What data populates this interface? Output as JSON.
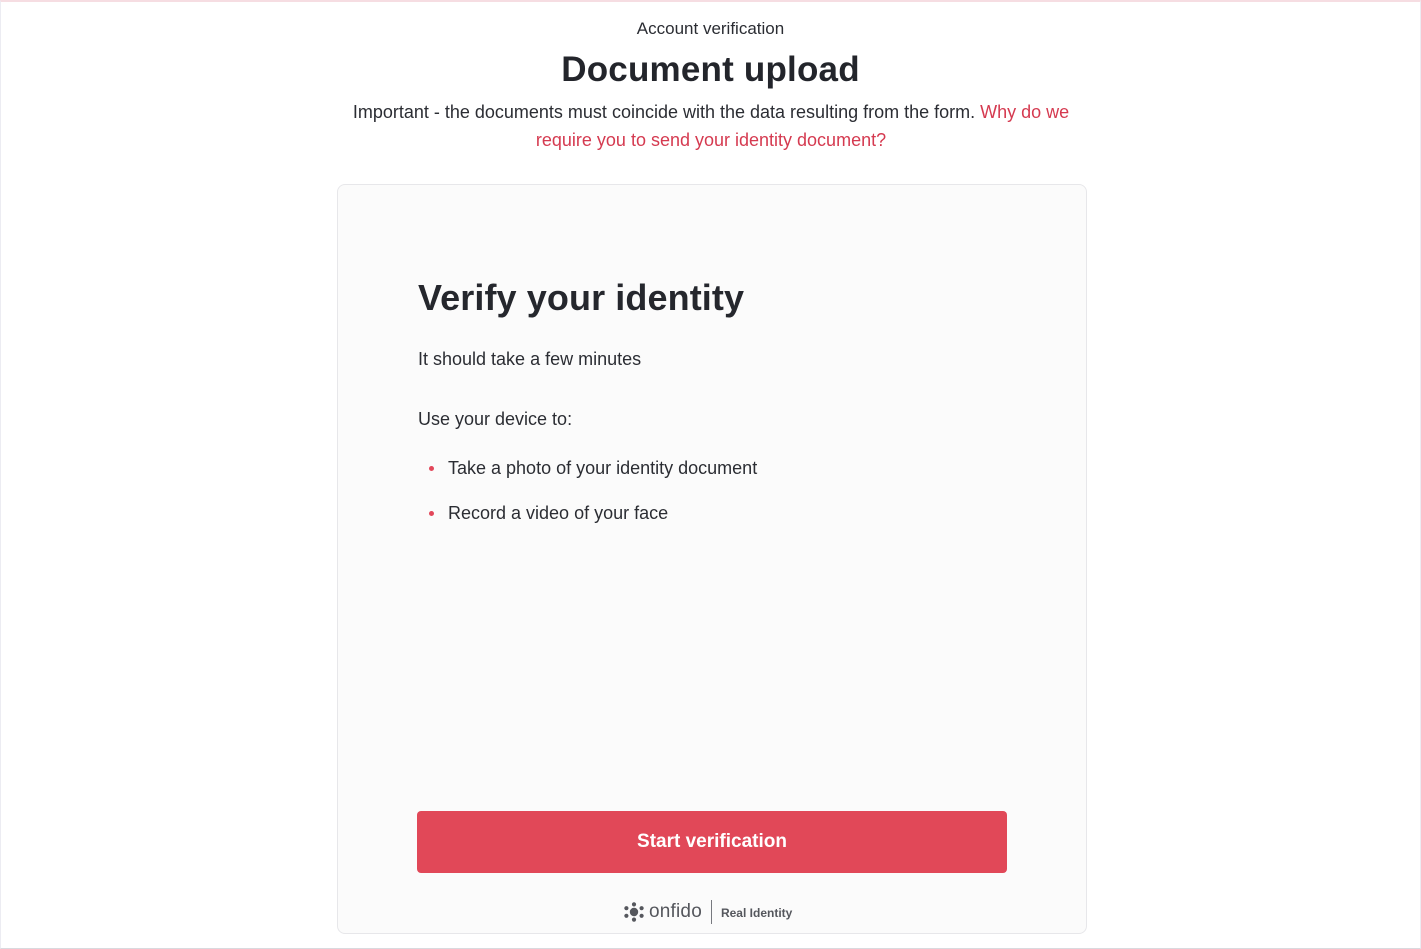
{
  "header": {
    "eyebrow": "Account verification",
    "title": "Document upload",
    "notice_text": "Important - the documents must coincide with the data resulting from the form. ",
    "notice_link": "Why do we require you to send your identity document?"
  },
  "card": {
    "title": "Verify your identity",
    "subtitle": "It should take a few minutes",
    "intro": "Use your device to:",
    "steps": [
      "Take a photo of your identity document",
      "Record a video of your face"
    ],
    "button_label": "Start verification",
    "brand_name": "onfido",
    "brand_tagline": "Real Identity"
  },
  "colors": {
    "accent": "#e14858",
    "link": "#d53a50",
    "card_background": "#fbfbfb"
  },
  "icons": {
    "bullet": "bullet-dot-icon",
    "brand": "onfido-logo-icon"
  }
}
